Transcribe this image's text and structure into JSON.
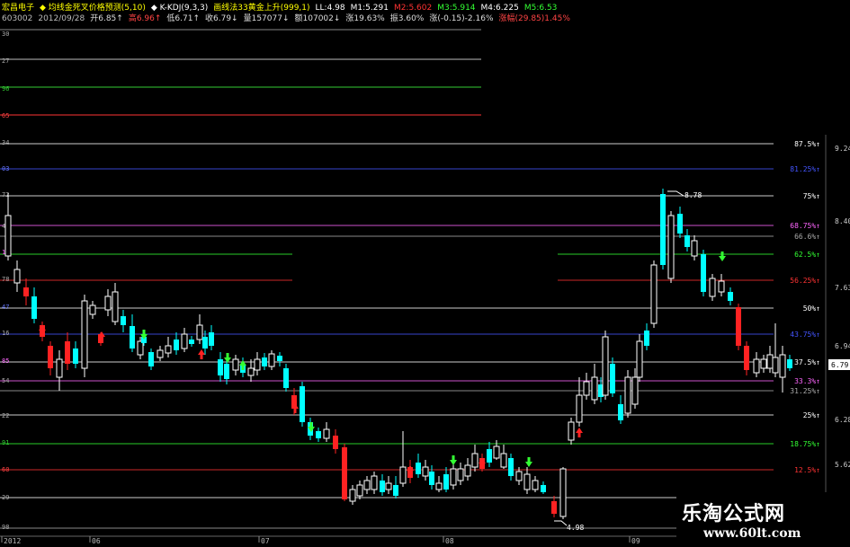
{
  "header": {
    "line1": [
      {
        "text": "宏昌电子",
        "color": "#ffff00"
      },
      {
        "text": "◆ 均线金死叉价格预测(5,10)",
        "color": "#ffff00"
      },
      {
        "text": "◆ K-KDJ(9,3,3)",
        "color": "#ffffff"
      },
      {
        "text": "画线法33黄金上升(999,1)",
        "color": "#ffff00"
      },
      {
        "text": "LL:4.98",
        "color": "#ffffff"
      },
      {
        "text": "M1:5.291",
        "color": "#ffffff"
      },
      {
        "text": "M2:5.602",
        "color": "#ff3333"
      },
      {
        "text": "M3:5.914",
        "color": "#33ff33"
      },
      {
        "text": "M4:6.225",
        "color": "#ffffff"
      },
      {
        "text": "M5:6.53",
        "color": "#33ff33"
      }
    ],
    "line2": [
      {
        "text": "603002",
        "color": "#bbbbbb"
      },
      {
        "text": "2012/09/28",
        "color": "#bbbbbb"
      },
      {
        "text": "开6.85↑",
        "color": "#dddddd"
      },
      {
        "text": "高6.96↑",
        "color": "#ff4444"
      },
      {
        "text": "低6.71↑",
        "color": "#dddddd"
      },
      {
        "text": "收6.79↓",
        "color": "#dddddd"
      },
      {
        "text": "量157077↓",
        "color": "#dddddd"
      },
      {
        "text": "额107002↓",
        "color": "#dddddd"
      },
      {
        "text": "涨19.63%",
        "color": "#dddddd"
      },
      {
        "text": "振3.60%",
        "color": "#dddddd"
      },
      {
        "text": "涨(-0.15)-2.16%",
        "color": "#dddddd"
      },
      {
        "text": "涨幅(29.85)1.45%",
        "color": "#ff4444"
      }
    ]
  },
  "left_axis_labels": [
    "30",
    "27",
    "96",
    "65",
    "34",
    "03",
    "72",
    "41",
    "10",
    "78",
    "47",
    "16",
    "85",
    "54",
    "22",
    "91",
    "60",
    "29",
    "98"
  ],
  "fib_levels": [
    {
      "label": "87.5%↑",
      "color": "#ffffff"
    },
    {
      "label": "81.25%↑",
      "color": "#4455ff"
    },
    {
      "label": "75%↑",
      "color": "#ffffff"
    },
    {
      "label": "68.75%↑",
      "color": "#ff66ff"
    },
    {
      "label": "66.6%↑",
      "color": "#aaaaaa"
    },
    {
      "label": "62.5%↑",
      "color": "#33ff33"
    },
    {
      "label": "56.25%↑",
      "color": "#ff3333"
    },
    {
      "label": "50%↑",
      "color": "#ffffff"
    },
    {
      "label": "43.75%↑",
      "color": "#4455ff"
    },
    {
      "label": "37.5%↑",
      "color": "#ffffff"
    },
    {
      "label": "33.3%↑",
      "color": "#ff66ff"
    },
    {
      "label": "31.25%↑",
      "color": "#aaaaaa"
    },
    {
      "label": "25%↑",
      "color": "#ffffff"
    },
    {
      "label": "18.75%↑",
      "color": "#33ff33"
    },
    {
      "label": "12.5%↑",
      "color": "#ff3333"
    }
  ],
  "right_price_labels": [
    "9.24",
    "8.40",
    "7.63",
    "6.94",
    "6.79",
    "6.28",
    "5.62"
  ],
  "current_price": "6.79",
  "annotations": {
    "high": "8.78",
    "low": "4.98"
  },
  "time_axis": [
    "2012",
    "06",
    "07",
    "08",
    "09"
  ],
  "watermark": {
    "title": "乐淘公式网",
    "url": "www.60lt.com"
  },
  "colors": {
    "up": "#00ffff",
    "down": "#ff2222",
    "neutral": "#ffffff",
    "background": "#000000"
  }
}
